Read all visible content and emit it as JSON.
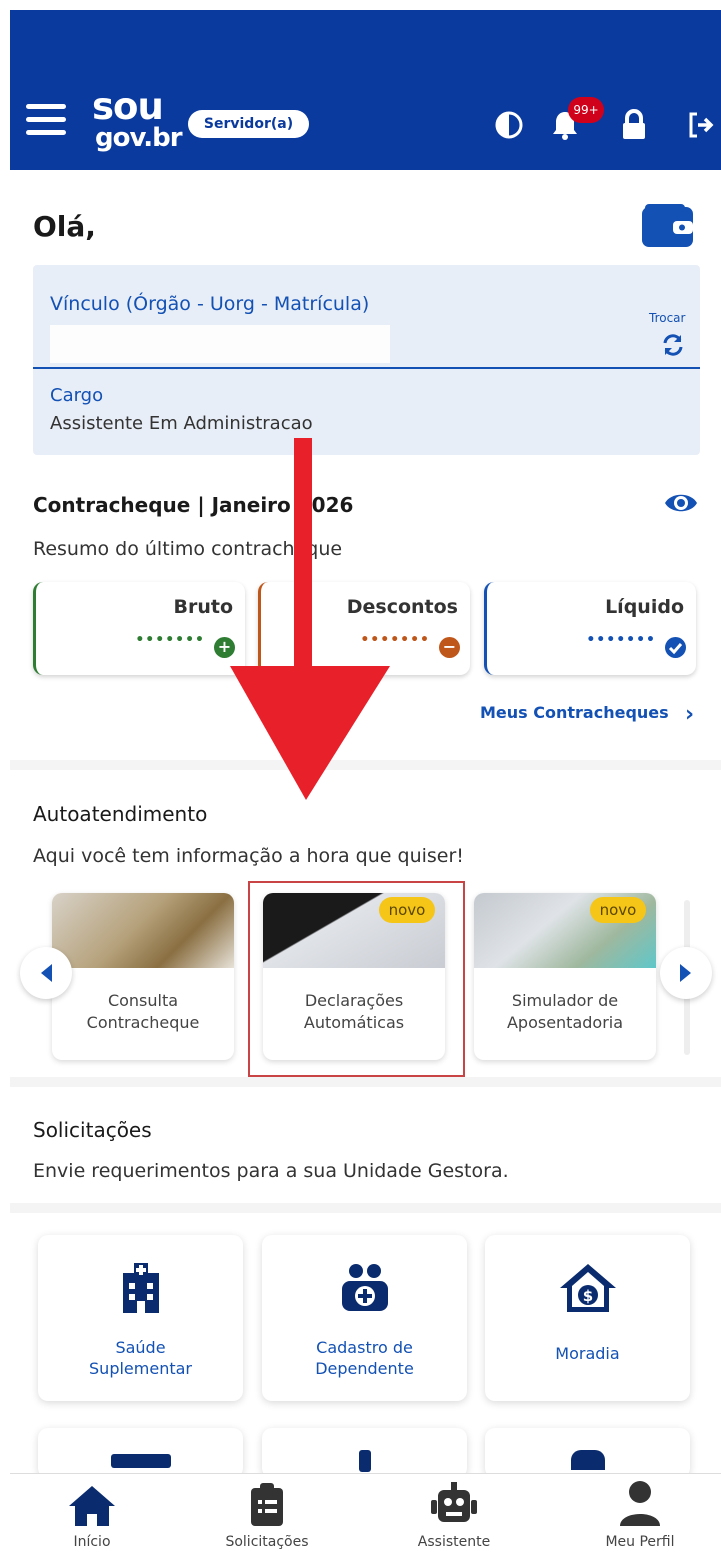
{
  "header": {
    "logo_top": "sou",
    "logo_bottom": "gov.br",
    "role_badge": "Servidor(a)",
    "notification_count": "99+",
    "icons": [
      "menu-icon",
      "contrast-icon",
      "bell-icon",
      "lock-icon",
      "logout-icon"
    ]
  },
  "greeting": "Olá,",
  "vinculo": {
    "title": "Vínculo (Órgão - Uorg - Matrícula)",
    "trocar_label": "Trocar",
    "cargo_label": "Cargo",
    "cargo_value": "Assistente Em Administracao"
  },
  "contracheque": {
    "title": "Contracheque | Janeiro 2026",
    "subtitle": "Resumo do último contracheque",
    "cards": [
      {
        "label": "Bruto",
        "masked": "•••••••",
        "color": "#2e7d32"
      },
      {
        "label": "Descontos",
        "masked": "•••••••",
        "color": "#c0571a"
      },
      {
        "label": "Líquido",
        "masked": "•••••••",
        "color": "#1351b4"
      }
    ],
    "link": "Meus Contracheques"
  },
  "autoatendimento": {
    "title": "Autoatendimento",
    "subtitle": "Aqui você tem informação a hora que quiser!",
    "cards": [
      {
        "line1": "Consulta",
        "line2": "Contracheque",
        "badge": ""
      },
      {
        "line1": "Declarações",
        "line2": "Automáticas",
        "badge": "novo"
      },
      {
        "line1": "Simulador de",
        "line2": "Aposentadoria",
        "badge": "novo"
      }
    ]
  },
  "solicitacoes": {
    "title": "Solicitações",
    "subtitle": "Envie requerimentos para a sua Unidade Gestora.",
    "cards": [
      {
        "line1": "Saúde",
        "line2": "Suplementar"
      },
      {
        "line1": "Cadastro de",
        "line2": "Dependente"
      },
      {
        "line1": "Moradia",
        "line2": ""
      }
    ]
  },
  "bottom_nav": [
    {
      "label": "Início",
      "icon": "home-icon"
    },
    {
      "label": "Solicitações",
      "icon": "clipboard-icon"
    },
    {
      "label": "Assistente",
      "icon": "robot-icon"
    },
    {
      "label": "Meu Perfil",
      "icon": "user-icon"
    }
  ],
  "colors": {
    "header": "#0a3a9e",
    "primary": "#1351b4",
    "badge_yellow": "#f5c518",
    "arrow_red": "#e8202a"
  }
}
